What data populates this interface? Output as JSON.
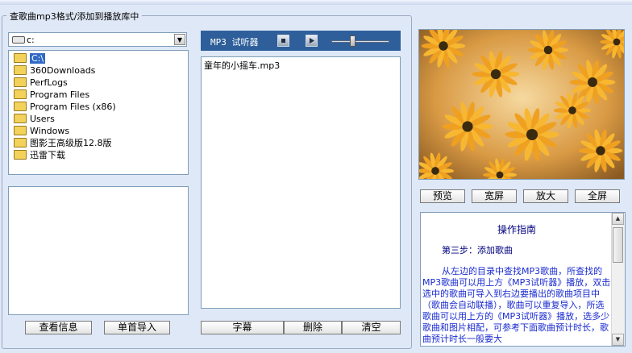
{
  "group_title": "查歌曲mp3格式/添加到播放库中",
  "drive": {
    "value": "c:"
  },
  "tree": {
    "items": [
      "C:\\",
      "360Downloads",
      "PerfLogs",
      "Program Files",
      "Program Files (x86)",
      "Users",
      "Windows",
      "图影王高级版12.8版",
      "迅雷下载"
    ]
  },
  "left_buttons": {
    "info": "查看信息",
    "import": "单首导入"
  },
  "player": {
    "title": "MP3 试听器",
    "volume_level": 0.35
  },
  "playlist": {
    "items": [
      "童年的小摇车.mp3"
    ]
  },
  "mid_buttons": {
    "subtitle": "字幕",
    "delete": "删除",
    "clear": "清空"
  },
  "photo_buttons": {
    "preview": "预览",
    "wide": "宽屏",
    "zoom": "放大",
    "fullscreen": "全屏"
  },
  "guide": {
    "heading": "操作指南",
    "step": "第三步：添加歌曲",
    "body": "从左边的目录中查找MP3歌曲，所查找的MP3歌曲可以用上方《MP3试听器》播放，双击选中的歌曲可导入到右边要播出的歌曲项目中（歌曲会自动联播），歌曲可以重复导入，所选歌曲可以用上方的《MP3试听器》播放，选多少歌曲和图片相配，可参考下面歌曲预计时长，歌曲预计时长一般要大"
  }
}
